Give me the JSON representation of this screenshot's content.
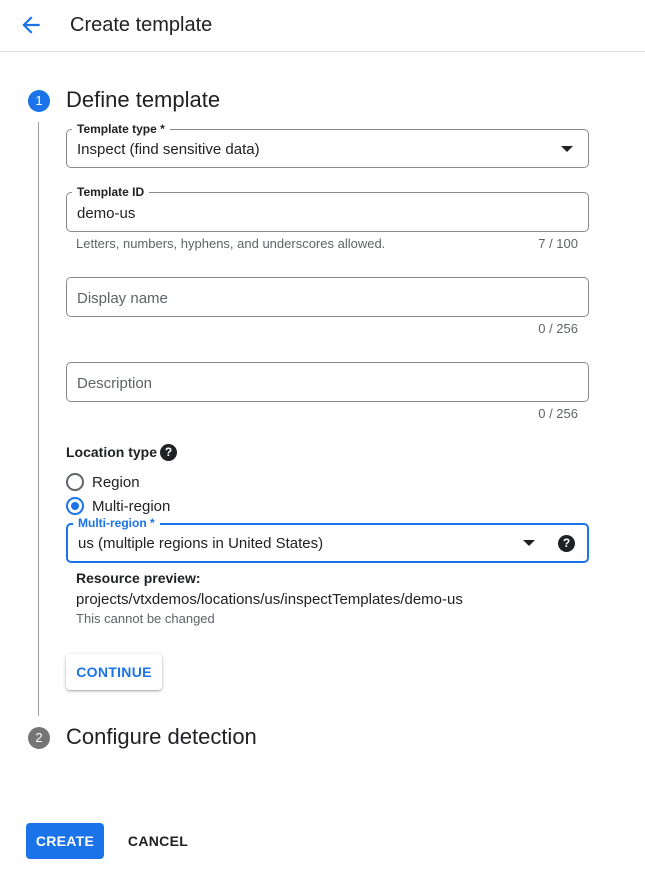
{
  "header": {
    "title": "Create template",
    "back_icon": "arrow-back-icon"
  },
  "colors": {
    "accent": "#1a73e8",
    "inactive_step": "#757575",
    "text_primary": "#202124",
    "text_secondary": "#5f6368"
  },
  "steps": [
    {
      "number": "1",
      "title": "Define template",
      "state": "active"
    },
    {
      "number": "2",
      "title": "Configure detection",
      "state": "inactive"
    }
  ],
  "form": {
    "template_type": {
      "label": "Template type *",
      "value": "Inspect (find sensitive data)"
    },
    "template_id": {
      "label": "Template ID",
      "value": "demo-us",
      "hint": "Letters, numbers, hyphens, and underscores allowed.",
      "counter": "7 / 100"
    },
    "display_name": {
      "placeholder": "Display name",
      "value": "",
      "counter": "0 / 256"
    },
    "description": {
      "placeholder": "Description",
      "value": "",
      "counter": "0 / 256"
    },
    "location_type": {
      "label": "Location type",
      "help_icon": "help-icon",
      "options": [
        {
          "label": "Region",
          "selected": false
        },
        {
          "label": "Multi-region",
          "selected": true
        }
      ]
    },
    "multi_region": {
      "label": "Multi-region *",
      "value": "us (multiple regions in United States)",
      "help_icon": "help-icon"
    },
    "resource_preview": {
      "label": "Resource preview:",
      "value": "projects/vtxdemos/locations/us/inspectTemplates/demo-us",
      "note": "This cannot be changed"
    },
    "continue_label": "CONTINUE"
  },
  "footer": {
    "create_label": "CREATE",
    "cancel_label": "CANCEL"
  }
}
